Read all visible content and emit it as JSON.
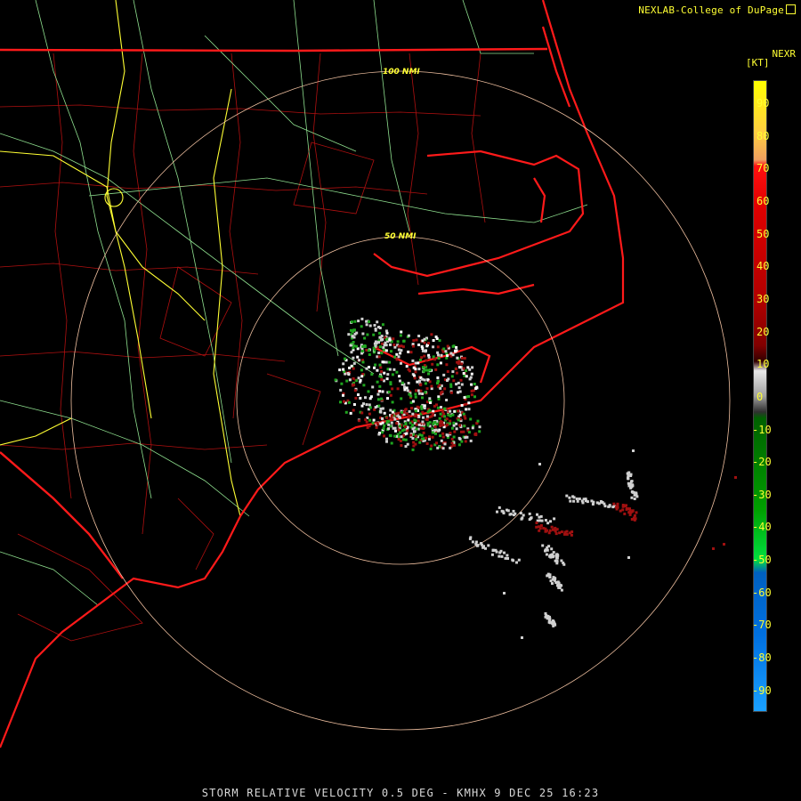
{
  "credit": "NEXLAB-College of DuPage",
  "legend": {
    "product": "NEXR",
    "unit": "[KT]",
    "ticks": [
      "90",
      "80",
      "70",
      "60",
      "50",
      "40",
      "30",
      "20",
      "10",
      "0",
      "-10",
      "-20",
      "-30",
      "-40",
      "-50",
      "-60",
      "-70",
      "-80",
      "-90"
    ]
  },
  "range_rings": [
    "50 NMI",
    "100 NMI"
  ],
  "caption": "STORM RELATIVE VELOCITY 0.5 DEG - KMHX 9 DEC 25 16:23",
  "colors": {
    "background": "#000000",
    "coast": "#ff1a1a",
    "county": "#b01010",
    "highway_state": "#8fe08f",
    "highway_interstate": "#ffff33",
    "ring": "#f0c0a0",
    "inbound_green": "#1fa51f",
    "outbound_red": "#a01010",
    "near_zero": "#d0d0d0"
  }
}
